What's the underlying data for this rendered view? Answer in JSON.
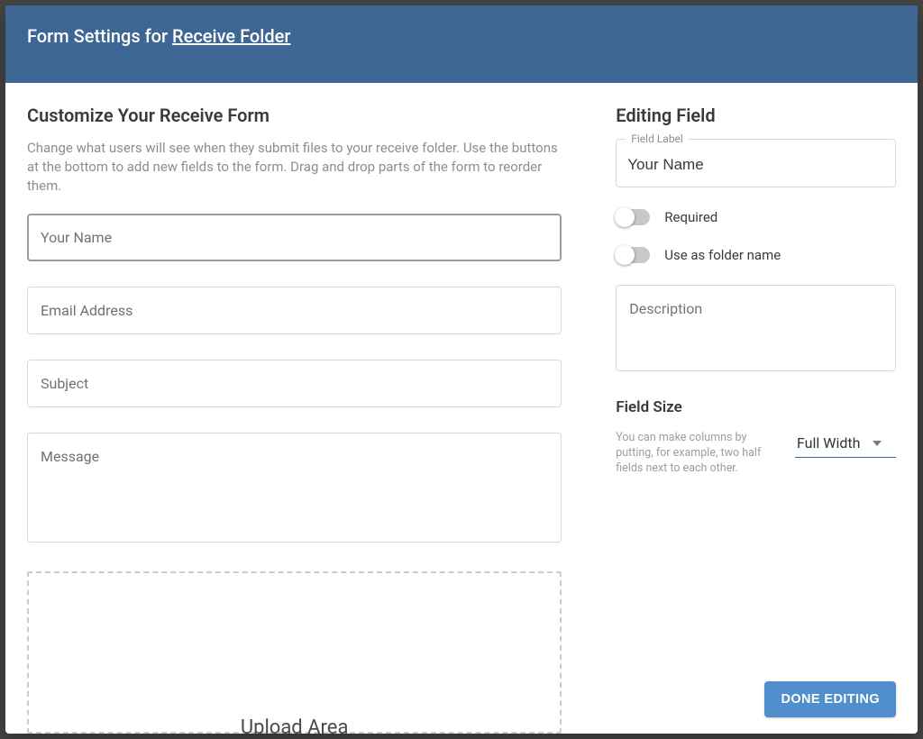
{
  "header": {
    "prefix": "Form Settings for ",
    "link": "Receive Folder"
  },
  "left": {
    "title": "Customize Your Receive Form",
    "description": "Change what users will see when they submit files to your receive folder. Use the buttons at the bottom to add new fields to the form. Drag and drop parts of the form to reorder them.",
    "fields": {
      "name": "Your Name",
      "email": "Email Address",
      "subject": "Subject",
      "message": "Message"
    },
    "upload": "Upload Area"
  },
  "right": {
    "title": "Editing Field",
    "fieldLabel": {
      "legend": "Field Label",
      "value": "Your Name"
    },
    "toggles": {
      "required": "Required",
      "folderName": "Use as folder name"
    },
    "descriptionPlaceholder": "Description",
    "fieldSize": {
      "title": "Field Size",
      "description": "You can make columns by putting, for example, two half fields next to each other.",
      "value": "Full Width"
    }
  },
  "footer": {
    "done": "DONE EDITING"
  }
}
